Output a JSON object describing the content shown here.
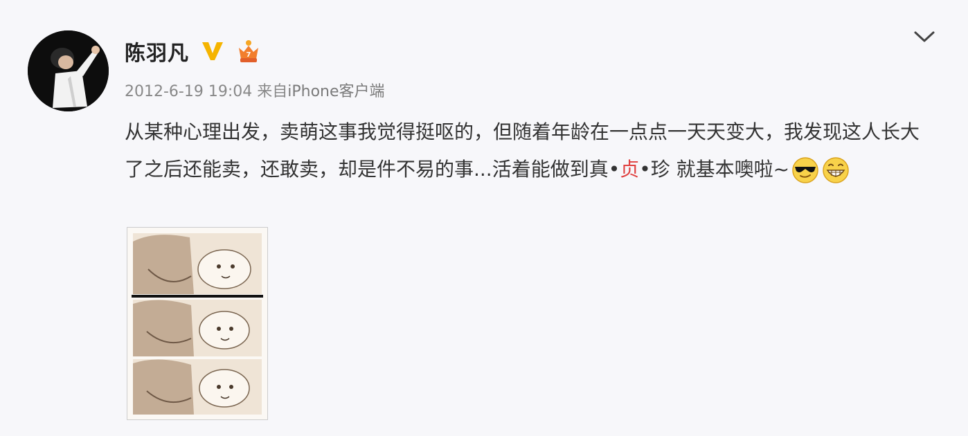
{
  "post": {
    "username": "陈羽凡",
    "timestamp": "2012-6-19 19:04",
    "source_prefix": "来自",
    "source": "iPhone客户端",
    "text": {
      "part1": "从某种心理出发，卖萌这事我觉得挺呕的，但随着年龄在一点点一天天变大，我发现这人长大了之后还能卖，还敢卖，却是件不易的事...活着能做到真•",
      "highlight": "贞",
      "part2": "•珍 就基本噢啦~"
    },
    "badges": [
      "verified-v-badge",
      "member-crown-badge"
    ],
    "emojis": [
      "cool-sunglasses-emoji",
      "grin-emoji"
    ],
    "image": "comic-strip-image"
  },
  "colors": {
    "background": "#f7f7fa",
    "text": "#333333",
    "meta": "#888888",
    "highlight": "#e0403f",
    "badge_v": "#f5b400",
    "crown": "#f27e2d"
  },
  "icons": {
    "menu": "chevron-down-icon"
  }
}
